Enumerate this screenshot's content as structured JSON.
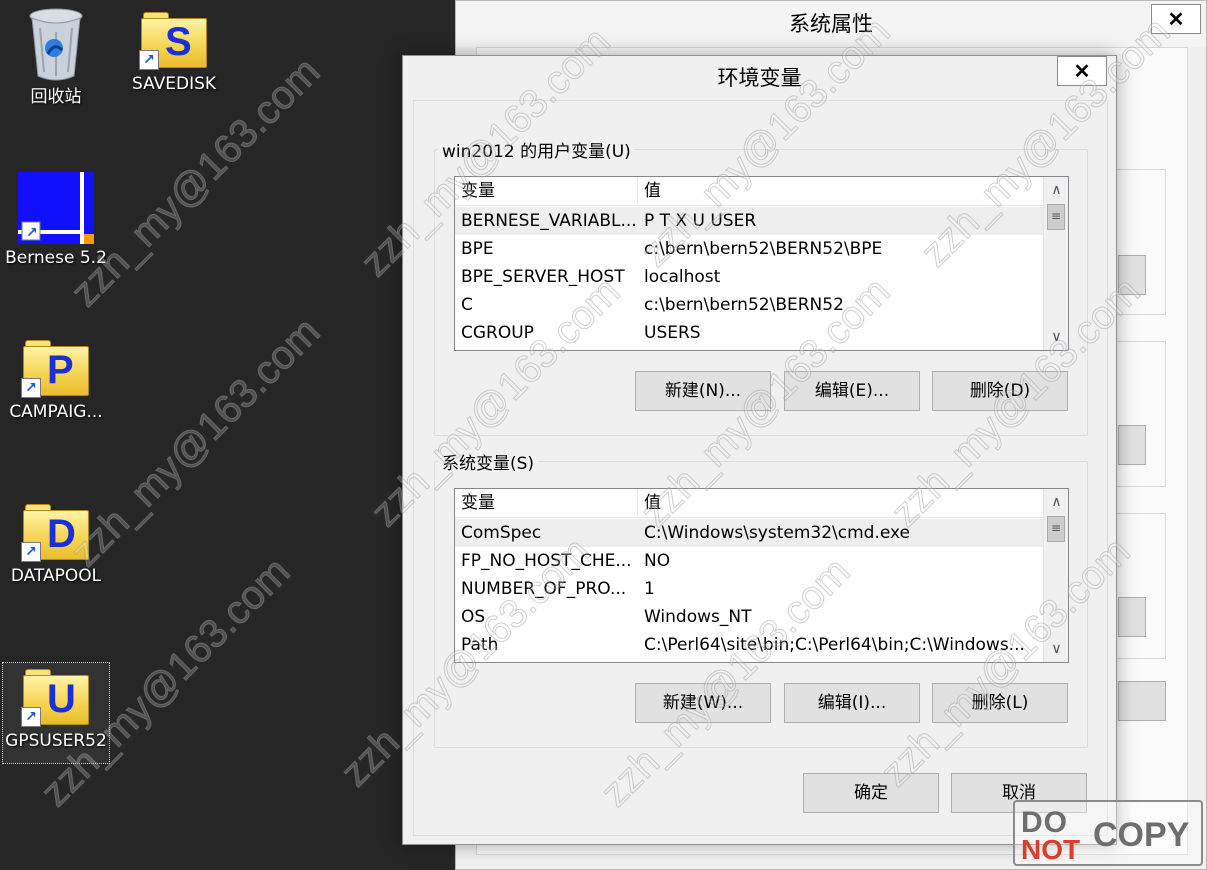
{
  "desktop": {
    "icons": [
      {
        "label": "回收站"
      },
      {
        "label": "SAVEDISK",
        "letter": "S"
      },
      {
        "label": "Bernese 5.2"
      },
      {
        "label": "CAMPAIG...",
        "letter": "P"
      },
      {
        "label": "DATAPOOL",
        "letter": "D"
      },
      {
        "label": "GPSUSER52",
        "letter": "U"
      }
    ]
  },
  "system_properties": {
    "title": "系统属性",
    "close_glyph": "✕"
  },
  "env_dialog": {
    "title": "环境变量",
    "close_glyph": "✕",
    "user_section": {
      "label": "win2012 的用户变量(U)",
      "columns": [
        "变量",
        "值"
      ],
      "rows": [
        {
          "name": "BERNESE_VARIABL...",
          "value": "P T X U USER"
        },
        {
          "name": "BPE",
          "value": "c:\\bern\\bern52\\BERN52\\BPE"
        },
        {
          "name": "BPE_SERVER_HOST",
          "value": "localhost"
        },
        {
          "name": "C",
          "value": "c:\\bern\\bern52\\BERN52"
        },
        {
          "name": "CGROUP",
          "value": "USERS"
        }
      ],
      "buttons": {
        "new": "新建(N)...",
        "edit": "编辑(E)...",
        "delete": "删除(D)"
      }
    },
    "system_section": {
      "label": "系统变量(S)",
      "columns": [
        "变量",
        "值"
      ],
      "rows": [
        {
          "name": "ComSpec",
          "value": "C:\\Windows\\system32\\cmd.exe"
        },
        {
          "name": "FP_NO_HOST_CHE...",
          "value": "NO"
        },
        {
          "name": "NUMBER_OF_PRO...",
          "value": "1"
        },
        {
          "name": "OS",
          "value": "Windows_NT"
        },
        {
          "name": "Path",
          "value": "C:\\Perl64\\site\\bin;C:\\Perl64\\bin;C:\\Windows..."
        }
      ],
      "buttons": {
        "new": "新建(W)...",
        "edit": "编辑(I)...",
        "delete": "删除(L)"
      }
    },
    "ok": "确定",
    "cancel": "取消"
  },
  "overlay": {
    "watermark_text": "zzh_my@163.com",
    "stamp": {
      "line1": "DO",
      "line2": "NOT",
      "line3": "COPY"
    }
  }
}
